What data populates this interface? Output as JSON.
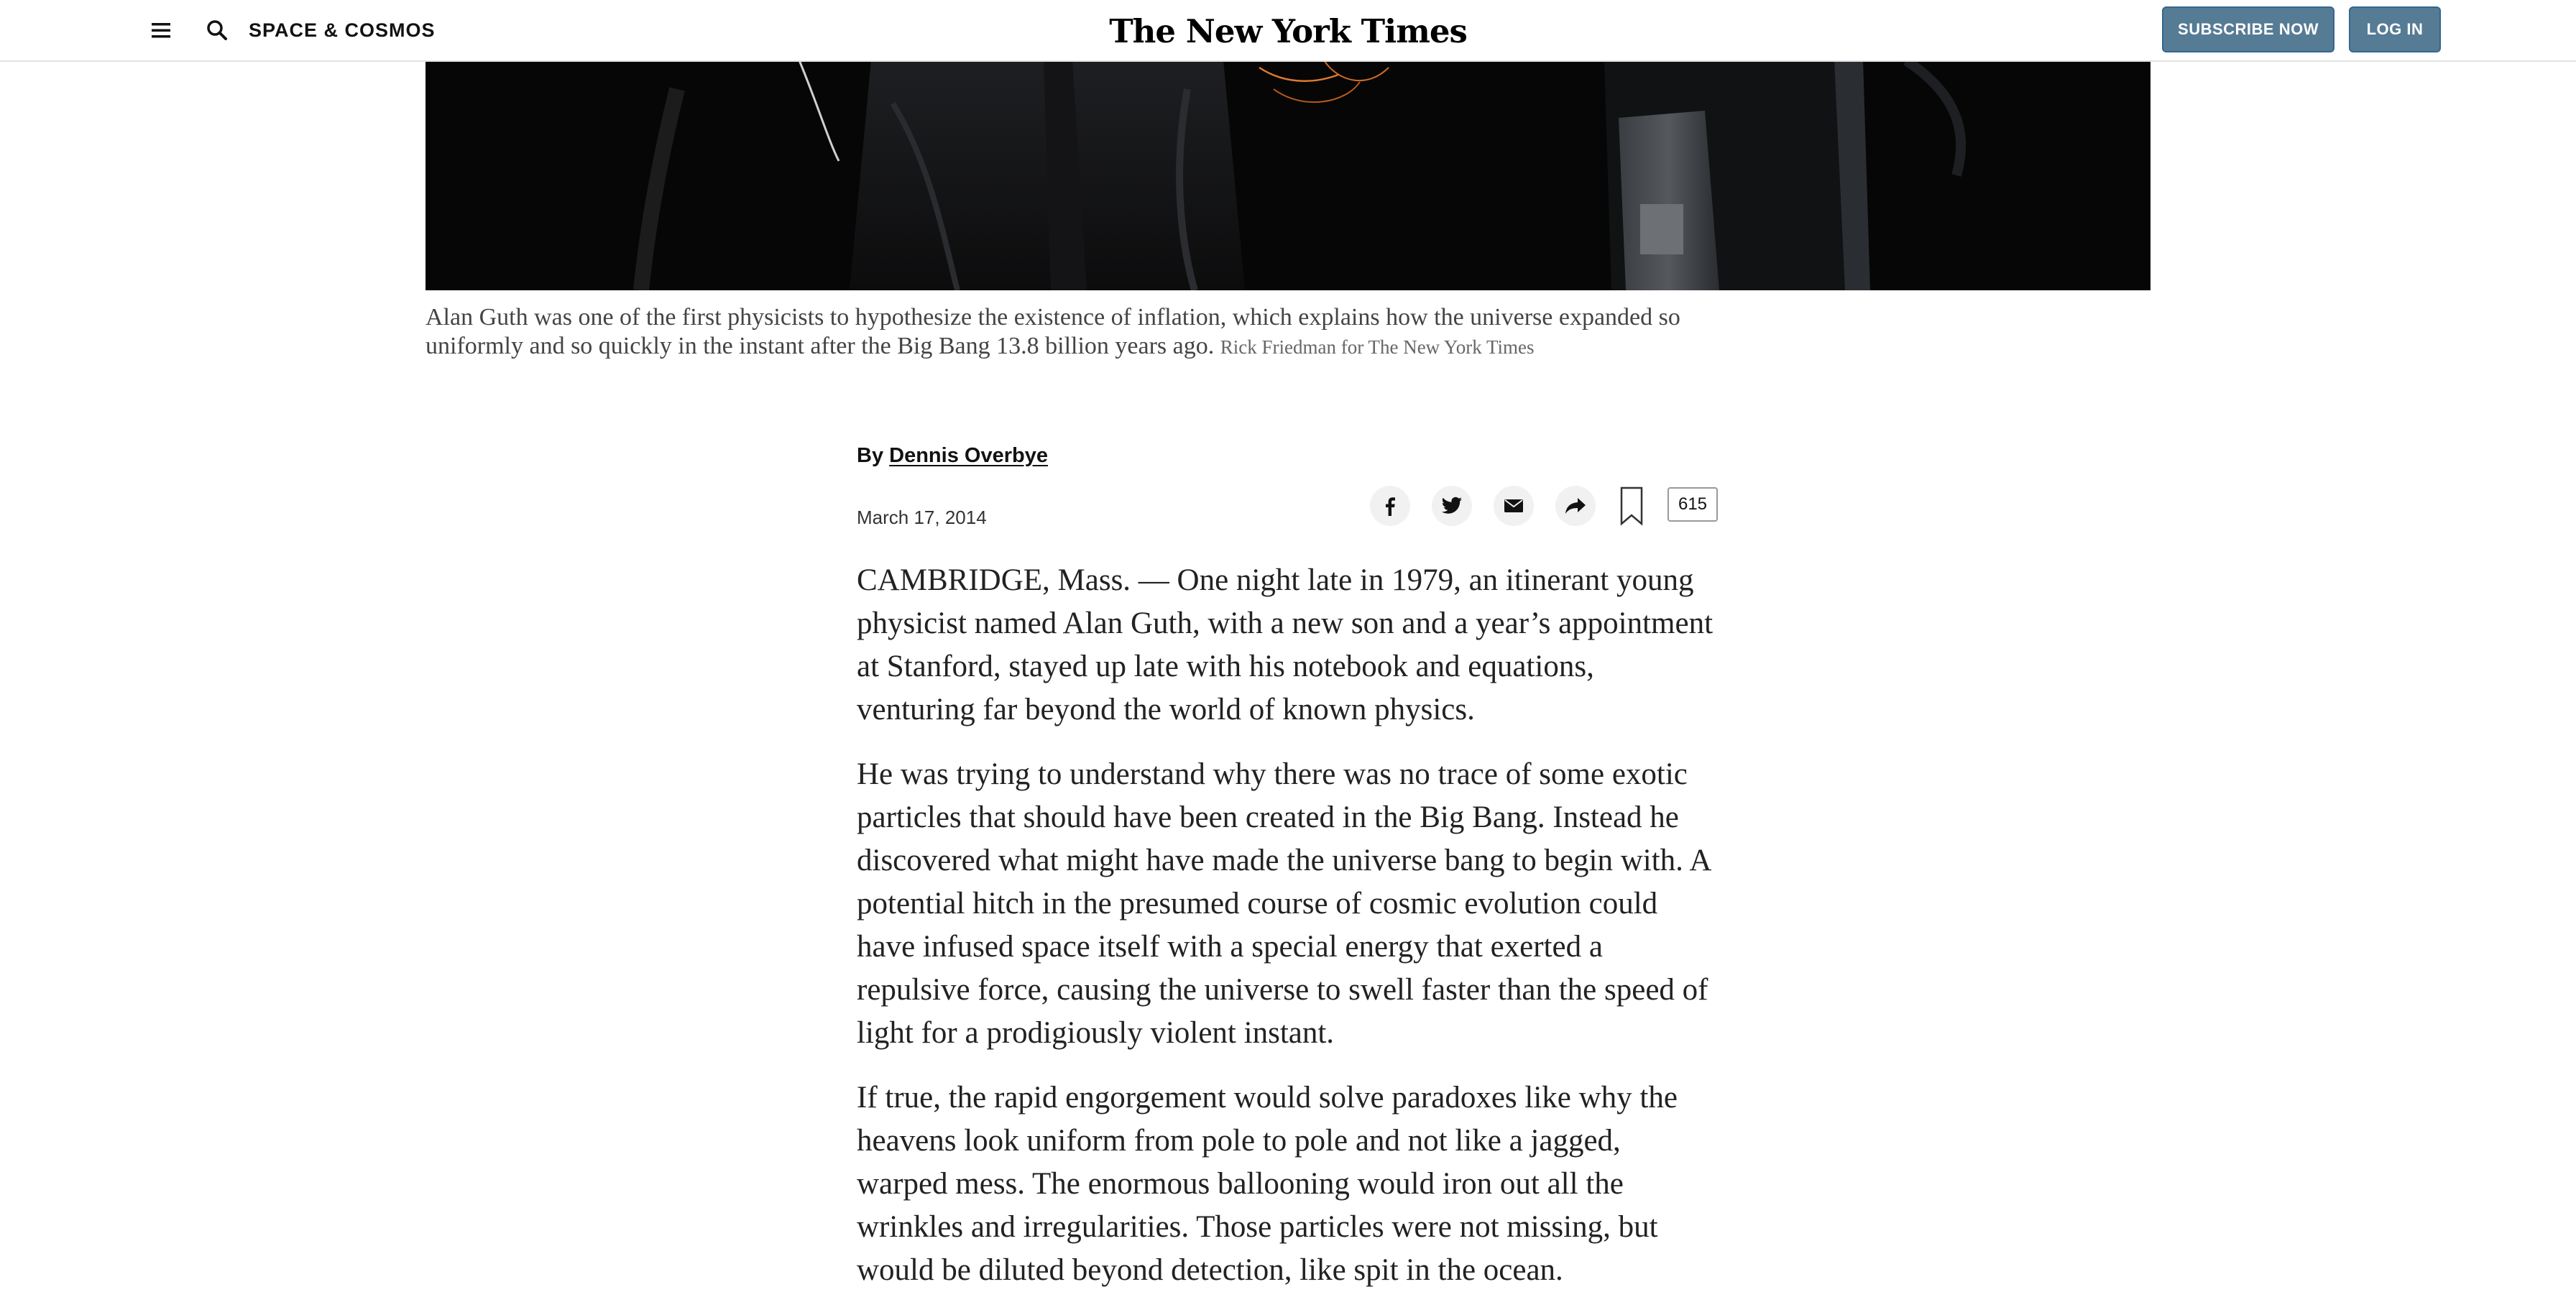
{
  "header": {
    "section": "SPACE & COSMOS",
    "logo_text": "The New York Times",
    "subscribe_label": "SUBSCRIBE NOW",
    "login_label": "LOG IN"
  },
  "hero": {
    "caption": "Alan Guth was one of the first physicists to hypothesize the existence of inflation, which explains how the universe expanded so uniformly and so quickly in the instant after the Big Bang 13.8 billion years ago.",
    "credit": "Rick Friedman for The New York Times"
  },
  "byline": {
    "prefix": "By",
    "author": "Dennis Overbye",
    "date": "March 17, 2014"
  },
  "share": {
    "comment_count": "615",
    "icons": [
      "facebook-icon",
      "twitter-icon",
      "email-icon",
      "share-icon",
      "bookmark-icon"
    ]
  },
  "article": {
    "paragraphs": [
      "CAMBRIDGE, Mass. — One night late in 1979, an itinerant young physicist named Alan Guth, with a new son and a year’s appointment at Stanford, stayed up late with his notebook and equations, venturing far beyond the world of known physics.",
      "He was trying to understand why there was no trace of some exotic particles that should have been created in the Big Bang. Instead he discovered what might have made the universe bang to begin with. A potential hitch in the presumed course of cosmic evolution could have infused space itself with a special energy that exerted a repulsive force, causing the universe to swell faster than the speed of light for a prodigiously violent instant.",
      "If true, the rapid engorgement would solve paradoxes like why the heavens look uniform from pole to pole and not like a jagged, warped mess. The enormous ballooning would iron out all the wrinkles and irregularities. Those particles were not missing, but would be diluted beyond detection, like spit in the ocean."
    ]
  },
  "colors": {
    "button_bg": "#567b95",
    "text": "#121212",
    "caption": "#444444"
  }
}
